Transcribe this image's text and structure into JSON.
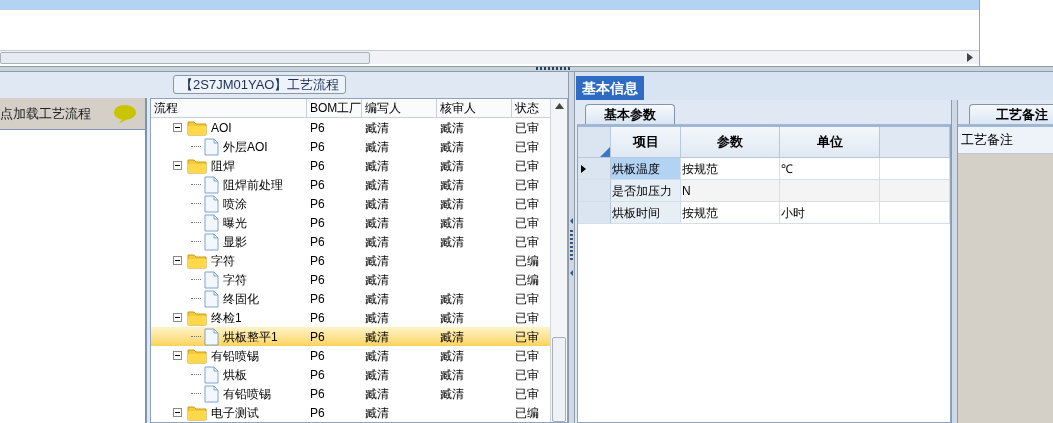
{
  "left_panel": {
    "title": "点加载工艺流程"
  },
  "process_group": {
    "legend": "【2S7JM01YAO】工艺流程",
    "columns": [
      "流程",
      "BOM工厂",
      "编写人",
      "核审人",
      "状态"
    ],
    "tree": [
      {
        "name": "AOI",
        "kind": "folder",
        "expanded": true,
        "selected": false,
        "cells": [
          "P6",
          "臧清",
          "臧清",
          "已审"
        ],
        "children": [
          {
            "name": "外层AOI",
            "kind": "file",
            "selected": false,
            "cells": [
              "P6",
              "臧清",
              "臧清",
              "已审"
            ]
          }
        ]
      },
      {
        "name": "阻焊",
        "kind": "folder",
        "expanded": true,
        "selected": false,
        "cells": [
          "P6",
          "臧清",
          "臧清",
          "已审"
        ],
        "children": [
          {
            "name": "阻焊前处理",
            "kind": "file",
            "selected": false,
            "cells": [
              "P6",
              "臧清",
              "臧清",
              "已审"
            ]
          },
          {
            "name": "喷涂",
            "kind": "file",
            "selected": false,
            "cells": [
              "P6",
              "臧清",
              "臧清",
              "已审"
            ]
          },
          {
            "name": "曝光",
            "kind": "file",
            "selected": false,
            "cells": [
              "P6",
              "臧清",
              "臧清",
              "已审"
            ]
          },
          {
            "name": "显影",
            "kind": "file",
            "selected": false,
            "cells": [
              "P6",
              "臧清",
              "臧清",
              "已审"
            ]
          }
        ]
      },
      {
        "name": "字符",
        "kind": "folder",
        "expanded": true,
        "selected": false,
        "cells": [
          "P6",
          "臧清",
          "",
          "已编"
        ],
        "children": [
          {
            "name": "字符",
            "kind": "file",
            "selected": false,
            "cells": [
              "P6",
              "臧清",
              "",
              "已编"
            ]
          },
          {
            "name": "终固化",
            "kind": "file",
            "selected": false,
            "cells": [
              "P6",
              "臧清",
              "臧清",
              "已审"
            ]
          }
        ]
      },
      {
        "name": "终检1",
        "kind": "folder",
        "expanded": true,
        "selected": false,
        "cells": [
          "P6",
          "臧清",
          "臧清",
          "已审"
        ],
        "children": [
          {
            "name": "烘板整平1",
            "kind": "file",
            "selected": true,
            "cells": [
              "P6",
              "臧清",
              "臧清",
              "已审"
            ]
          }
        ]
      },
      {
        "name": "有铅喷锡",
        "kind": "folder",
        "expanded": true,
        "selected": false,
        "cells": [
          "P6",
          "臧清",
          "臧清",
          "已审"
        ],
        "children": [
          {
            "name": "烘板",
            "kind": "file",
            "selected": false,
            "cells": [
              "P6",
              "臧清",
              "臧清",
              "已审"
            ]
          },
          {
            "name": "有铅喷锡",
            "kind": "file",
            "selected": false,
            "cells": [
              "P6",
              "臧清",
              "臧清",
              "已审"
            ]
          }
        ]
      },
      {
        "name": "电子测试",
        "kind": "folder",
        "expanded": true,
        "selected": false,
        "cells": [
          "P6",
          "臧清",
          "",
          "已编"
        ]
      }
    ]
  },
  "main_tabs": [
    {
      "label": "基本信息",
      "selected": true
    }
  ],
  "params": {
    "tab": "基本参数",
    "columns": [
      "项目",
      "参数",
      "单位"
    ],
    "rows": [
      {
        "cells": [
          "烘板温度",
          "按规范",
          "℃"
        ],
        "selected": true
      },
      {
        "cells": [
          "是否加压力",
          "N",
          ""
        ],
        "selected": false
      },
      {
        "cells": [
          "烘板时间",
          "按规范",
          "小时"
        ],
        "selected": false
      }
    ]
  },
  "remarks": {
    "tab": "工艺备注",
    "label": "工艺备注"
  }
}
